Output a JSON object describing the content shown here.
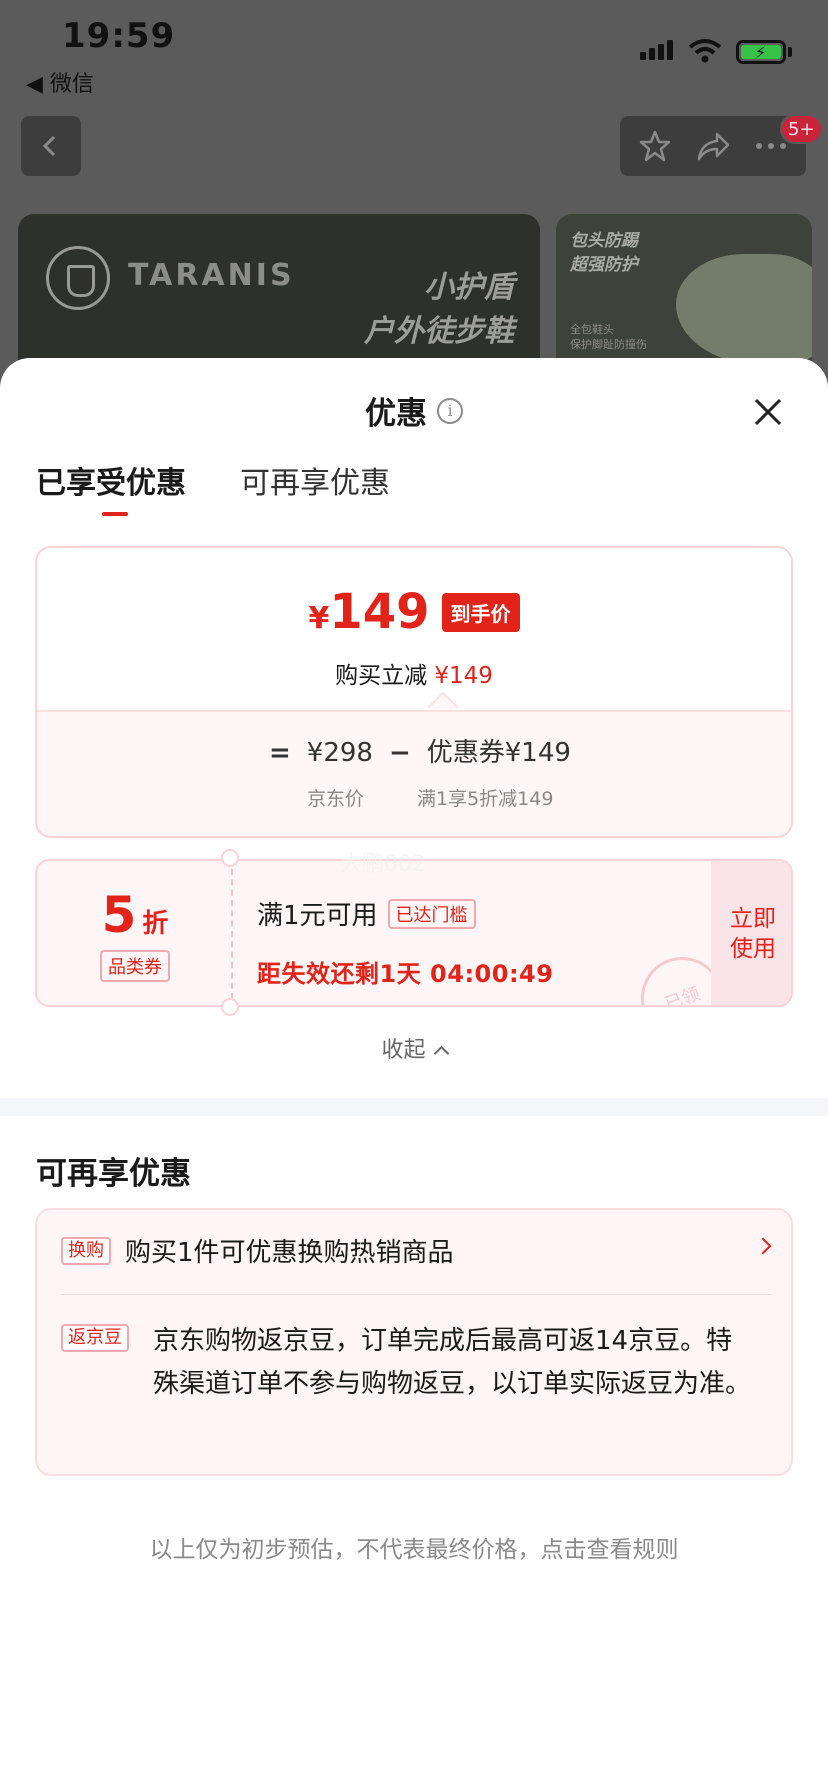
{
  "status_bar": {
    "time": "19:59",
    "back_app": "◀ 微信"
  },
  "nav": {
    "badge": "5+"
  },
  "banner": {
    "brand": "TARANIS",
    "slogan_line1": "小护盾",
    "slogan_line2": "户外徒步鞋",
    "side_line1": "包头防踢",
    "side_line2": "超强防护",
    "side_small1": "全包鞋头",
    "side_small2": "保护脚趾防撞伤"
  },
  "sheet": {
    "title": "优惠",
    "tabs": [
      {
        "label": "已享受优惠",
        "active": true
      },
      {
        "label": "可再享优惠",
        "active": false
      }
    ],
    "price_card": {
      "currency": "¥",
      "final_price": "149",
      "final_tag": "到手价",
      "reduce_label": "购买立减",
      "reduce_amount": "¥149",
      "equals": "=",
      "original_price": "¥298",
      "minus": "−",
      "coupon_amount": "优惠券¥149",
      "original_label": "京东价",
      "coupon_rule": "满1享5折减149"
    },
    "coupon": {
      "discount": "5",
      "discount_unit": "折",
      "category": "品类券",
      "condition": "满1元可用",
      "reached": "已达门槛",
      "countdown": "距失效还剩1天 04:00:49",
      "use_label": "立即使用",
      "stamp": "已领"
    },
    "watermark": "大鹏002",
    "collapse_label": "收起",
    "more_title": "可再享优惠",
    "benefits": [
      {
        "tag": "换购",
        "text": "购买1件可优惠换购热销商品"
      },
      {
        "tag": "返京豆",
        "text": "京东购物返京豆，订单完成后最高可返14京豆。特殊渠道订单不参与购物返豆，以订单实际返豆为准。"
      }
    ],
    "footnote": "以上仅为初步预估，不代表最终价格，点击查看规则"
  },
  "colors": {
    "accent": "#e2231a",
    "card_border": "#fbd3d7",
    "card_bg": "#fdf5f6"
  }
}
